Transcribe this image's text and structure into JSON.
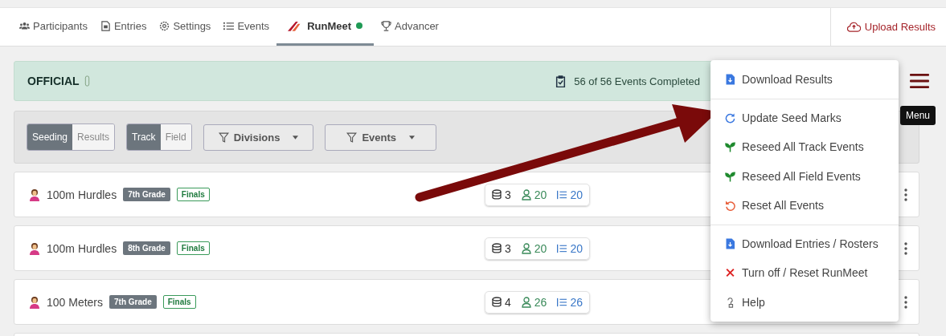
{
  "nav": {
    "tabs": [
      {
        "kind": "people",
        "label": "Participants",
        "selected": false,
        "connected": false
      },
      {
        "kind": "file",
        "label": "Entries",
        "selected": false,
        "connected": false
      },
      {
        "kind": "gear",
        "label": "Settings",
        "selected": false,
        "connected": false
      },
      {
        "kind": "list",
        "label": "Events",
        "selected": false,
        "connected": false
      },
      {
        "kind": "logo",
        "label": "RunMeet",
        "selected": true,
        "connected": true
      },
      {
        "kind": "trophy",
        "label": "Advancer",
        "selected": false,
        "connected": false
      }
    ],
    "upload_button": "Upload Results"
  },
  "status": {
    "label": "OFFICIAL",
    "completed": "56 of 56 Events Completed"
  },
  "menu_button": {
    "tooltip": "Menu"
  },
  "filters": {
    "toggles": [
      [
        {
          "label": "Seeding",
          "selected": true
        },
        {
          "label": "Results",
          "selected": false
        }
      ],
      [
        {
          "label": "Track",
          "selected": true
        },
        {
          "label": "Field",
          "selected": false
        }
      ]
    ],
    "dropdowns": [
      "Divisions",
      "Events"
    ]
  },
  "events": [
    {
      "name": "100m Hurdles",
      "grade": "7th Grade",
      "round": "Finals",
      "heats": "3",
      "athletes": "20",
      "entries": "20"
    },
    {
      "name": "100m Hurdles",
      "grade": "8th Grade",
      "round": "Finals",
      "heats": "3",
      "athletes": "20",
      "entries": "20"
    },
    {
      "name": "100 Meters",
      "grade": "7th Grade",
      "round": "Finals",
      "heats": "4",
      "athletes": "26",
      "entries": "26"
    }
  ],
  "menu": {
    "groups": [
      [
        {
          "kind": "file",
          "label": "Download Results"
        }
      ],
      [
        {
          "kind": "refresh",
          "label": "Update Seed Marks"
        },
        {
          "kind": "sprout",
          "label": "Reseed All Track Events"
        },
        {
          "kind": "sprout",
          "label": "Reseed All Field Events"
        },
        {
          "kind": "undo",
          "label": "Reset All Events"
        }
      ],
      [
        {
          "kind": "file",
          "label": "Download Entries / Rosters"
        },
        {
          "kind": "cross",
          "label": "Turn off / Reset RunMeet"
        },
        {
          "kind": "help",
          "label": "Help"
        }
      ]
    ]
  }
}
